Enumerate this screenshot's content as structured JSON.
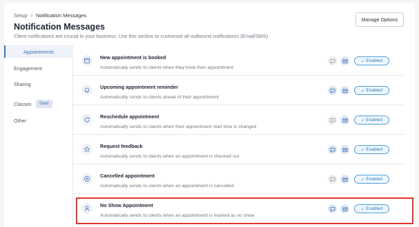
{
  "breadcrumb": {
    "root": "Setup",
    "separator": ">",
    "current": "Notification Messages"
  },
  "header": {
    "title": "Notification Messages",
    "subtitle": "Client notifications are crucial to your business. Use this section to customize all outbound notifications (Email/SMS)",
    "manage_button": "Manage Options"
  },
  "sidebar": {
    "items": [
      {
        "label": "Appointments",
        "active": true
      },
      {
        "label": "Engagement"
      },
      {
        "label": "Sharing"
      },
      {
        "label": "Classes",
        "badge": "Soon"
      },
      {
        "label": "Other"
      }
    ]
  },
  "notifications": [
    {
      "title": "New appointment is booked",
      "description": "Automatically sends to clients when they book their appointment",
      "icon": "calendar-icon",
      "sms_active": false,
      "status": "Enabled"
    },
    {
      "title": "Upcoming appointment reminder",
      "description": "Automatically sends to clients ahead of their appointment",
      "icon": "bell-icon",
      "sms_active": true,
      "status": "Enabled"
    },
    {
      "title": "Reschedule appointment",
      "description": "Automatically sends to clients when their appointment start time is changed",
      "icon": "refresh-icon",
      "sms_active": false,
      "status": "Enabled"
    },
    {
      "title": "Request feedback",
      "description": "Automatically sends to clients when an appointment is checked out",
      "icon": "star-icon",
      "sms_active": true,
      "status": "Enabled"
    },
    {
      "title": "Cancelled appointment",
      "description": "Automatically sends to clients when an appointment is cancelled",
      "icon": "x-circle-icon",
      "sms_active": false,
      "status": "Enabled"
    },
    {
      "title": "No Show Appointment",
      "description": "Automatically sends to clients when an appointment is marked as no show",
      "icon": "user-icon",
      "sms_active": true,
      "status": "Enabled"
    }
  ],
  "colors": {
    "accent": "#3d6fb5",
    "status_border": "#4a9fd8",
    "highlight": "#e5322b",
    "sms_active_bg": "#dbe6f3",
    "sms_inactive_bg": "#ececec"
  }
}
